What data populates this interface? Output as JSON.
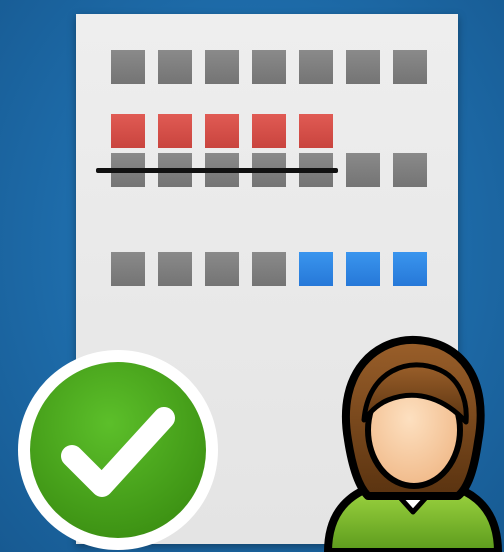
{
  "icon": "reservation-confirmed-user-icon",
  "document": {
    "icon": "seat-map-document",
    "rows": [
      {
        "name": "row-1",
        "seats": [
          "gray",
          "gray",
          "gray",
          "gray",
          "gray",
          "gray",
          "gray"
        ]
      },
      {
        "name": "row-2",
        "seats": [
          "red",
          "red",
          "red",
          "red",
          "red"
        ]
      },
      {
        "name": "row-3",
        "seats": [
          "gray",
          "gray",
          "gray",
          "gray",
          "gray",
          "gray",
          "gray"
        ]
      },
      {
        "name": "row-4",
        "seats": [
          "gray",
          "gray",
          "gray",
          "gray",
          "blue",
          "blue",
          "blue"
        ]
      }
    ]
  },
  "colors": {
    "background": "#1f6fae",
    "paper": "#e9e9e9",
    "seat_gray": "#7d7d7d",
    "seat_red": "#d44f49",
    "seat_blue": "#2e86e4",
    "check_green": "#4aa51c",
    "avatar_shirt": "#7cbf2a",
    "avatar_hair": "#7a4a1c"
  },
  "badges": {
    "check": "check-mark-icon",
    "avatar": "female-user-icon"
  }
}
